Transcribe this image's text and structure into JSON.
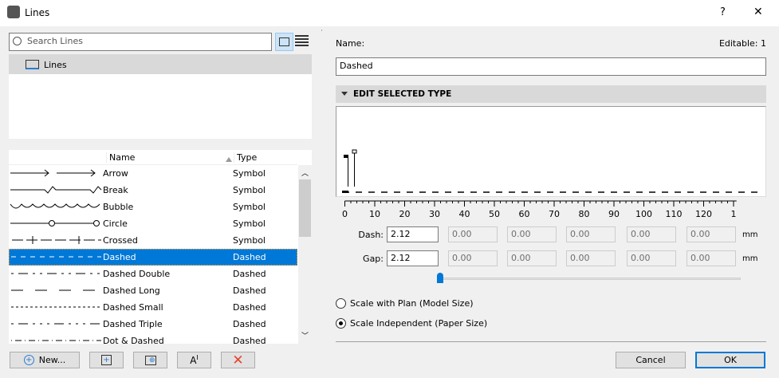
{
  "window": {
    "title": "Lines",
    "help": "?",
    "close": "✕"
  },
  "left": {
    "search_placeholder": "Search Lines",
    "tree": [
      {
        "label": "Lines"
      }
    ],
    "columns": {
      "name": "Name",
      "type": "Type"
    },
    "rows": [
      {
        "name": "Arrow",
        "type": "Symbol",
        "preview": "arrow"
      },
      {
        "name": "Break",
        "type": "Symbol",
        "preview": "break"
      },
      {
        "name": "Bubble",
        "type": "Symbol",
        "preview": "bubble"
      },
      {
        "name": "Circle",
        "type": "Symbol",
        "preview": "circle"
      },
      {
        "name": "Crossed",
        "type": "Symbol",
        "preview": "crossed"
      },
      {
        "name": "Dashed",
        "type": "Dashed",
        "preview": "6 6",
        "selected": true
      },
      {
        "name": "Dashed Double",
        "type": "Dashed",
        "preview": "3 6 12 6 3 6"
      },
      {
        "name": "Dashed Long",
        "type": "Dashed",
        "preview": "15 15"
      },
      {
        "name": "Dashed Small",
        "type": "Dashed",
        "preview": "3 3"
      },
      {
        "name": "Dashed Triple",
        "type": "Dashed",
        "preview": "3 6 12 6 3 6 3 6"
      },
      {
        "name": "Dot & Dashed",
        "type": "Dashed",
        "preview": "1 4 8 4"
      }
    ],
    "buttons": {
      "new": "New..."
    }
  },
  "right": {
    "name_label": "Name:",
    "editable": "Editable: 1",
    "name_value": "Dashed",
    "section": "EDIT SELECTED TYPE",
    "ruler": [
      "0",
      "10",
      "20",
      "30",
      "40",
      "50",
      "60",
      "70",
      "80",
      "90",
      "100",
      "110",
      "120",
      "1"
    ],
    "dash_label": "Dash:",
    "gap_label": "Gap:",
    "unit": "mm",
    "dash": [
      "2.12",
      "0.00",
      "0.00",
      "0.00",
      "0.00",
      "0.00"
    ],
    "gap": [
      "2.12",
      "0.00",
      "0.00",
      "0.00",
      "0.00",
      "0.00"
    ],
    "slider_value": 0,
    "scale_plan": "Scale with Plan (Model Size)",
    "scale_paper": "Scale Independent (Paper Size)",
    "selected_scale": "paper",
    "cancel": "Cancel",
    "ok": "OK"
  },
  "colors": {
    "accent": "#0078d7",
    "delete": "#e8412c"
  }
}
